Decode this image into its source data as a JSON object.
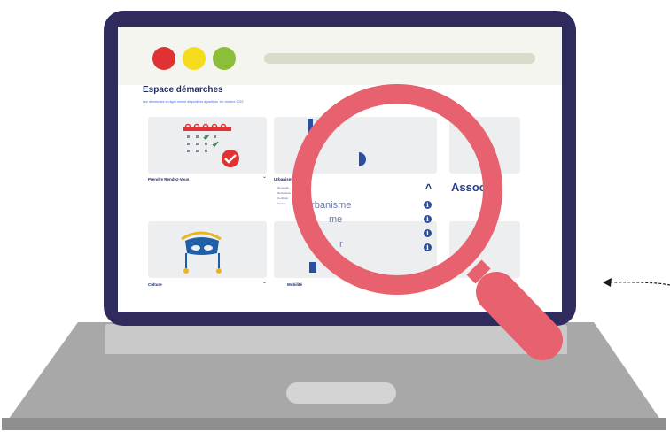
{
  "browser": {
    "dots": [
      "#e03232",
      "#f5dd1e",
      "#8cbe3a"
    ]
  },
  "page": {
    "title": "Espace démarches",
    "subtitle": "Les démarches en ligne seront disponibles à partir du 1er octobre 2022"
  },
  "cards": [
    {
      "label": "Prendre Rendez-Vous",
      "chevron": "⌄"
    },
    {
      "label": "Urbanisme",
      "chevron": "⌄"
    },
    {
      "label": "Culture",
      "chevron": "⌄"
    },
    {
      "label": "Mobilité",
      "chevron": "⌄"
    }
  ],
  "urbanisme_list": [
    "Demande",
    "Déclaration",
    "Certificat",
    "Permis"
  ],
  "magnified": {
    "items": [
      "urbanisme",
      "me",
      "r"
    ],
    "associations_label": "Associ",
    "caret": "^",
    "info_glyph": "i"
  },
  "colors": {
    "laptop_frame": "#2f2b5c",
    "magnifier": "#e8616f",
    "title_navy": "#1c2d6b",
    "subtitle_blue": "#3a6fd8"
  },
  "icons": {
    "magnifier": "magnifying-glass-icon",
    "arrow": "dashed-arrow-icon"
  }
}
